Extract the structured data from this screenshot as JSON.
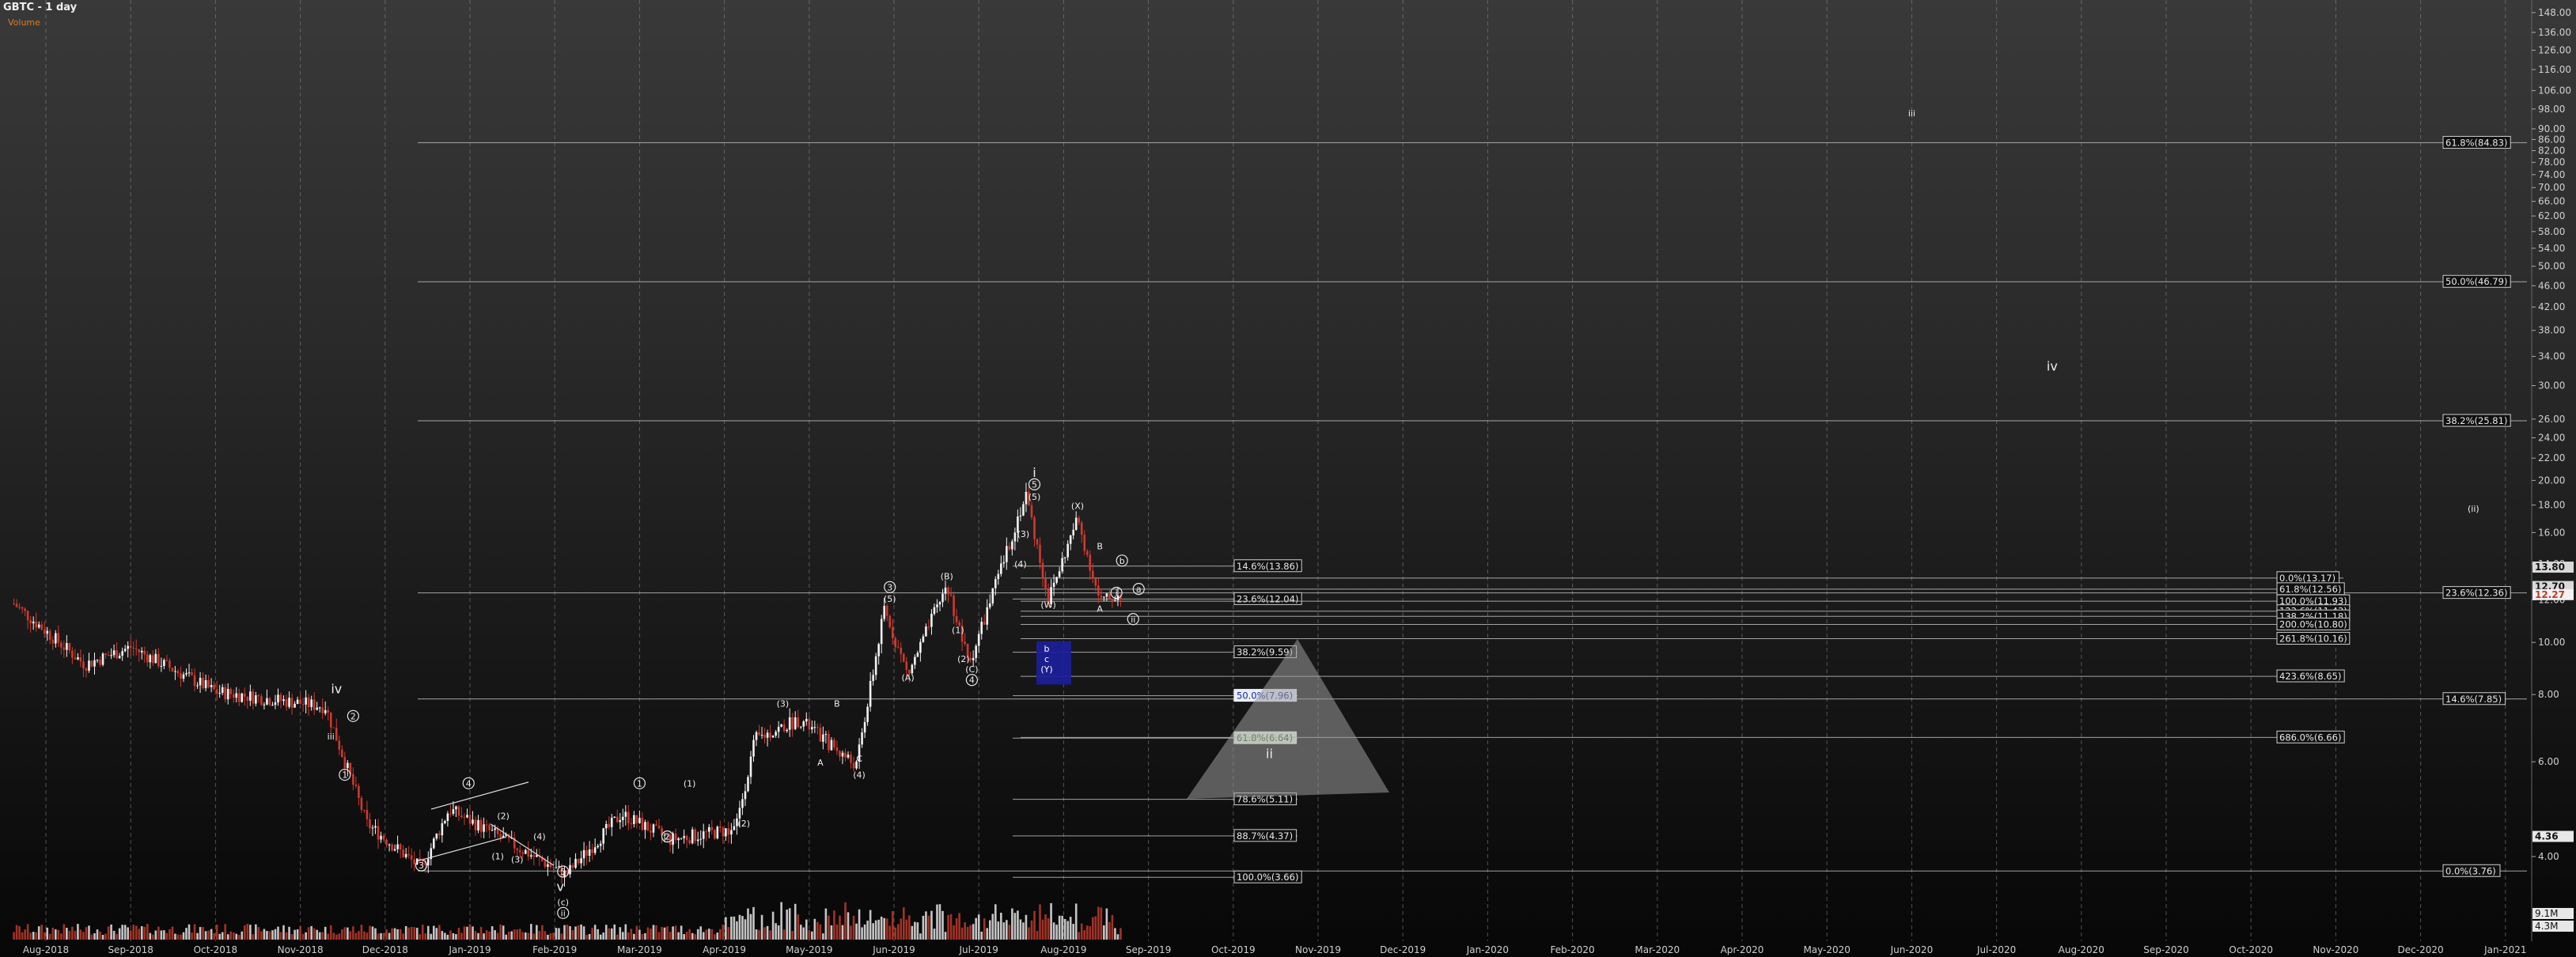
{
  "chart_data": {
    "type": "candlestick",
    "title": "GBTC - 1 day",
    "subtitle": "Volume",
    "x_ticks": [
      "Aug-2018",
      "Sep-2018",
      "Oct-2018",
      "Nov-2018",
      "Dec-2018",
      "Jan-2019",
      "Feb-2019",
      "Mar-2019",
      "Apr-2019",
      "May-2019",
      "Jun-2019",
      "Jul-2019",
      "Aug-2019",
      "Sep-2019",
      "Oct-2019",
      "Nov-2019",
      "Dec-2019",
      "Jan-2020",
      "Feb-2020",
      "Mar-2020",
      "Apr-2020",
      "May-2020",
      "Jun-2020",
      "Jul-2020",
      "Aug-2020",
      "Sep-2020",
      "Oct-2020",
      "Nov-2020",
      "Dec-2020",
      "Jan-2021"
    ],
    "y_scale": "log",
    "ylim": [
      3.0,
      150
    ],
    "y_ticks": [
      4.0,
      6.0,
      8.0,
      10.0,
      12.0,
      14.0,
      16.0,
      18.0,
      20.0,
      22.0,
      24.0,
      26.0,
      30.0,
      34.0,
      38.0,
      42.0,
      46.0,
      50.0,
      54.0,
      58.0,
      62.0,
      66.0,
      70.0,
      74.0,
      78.0,
      82.0,
      86.0,
      90.0,
      98.0,
      106.0,
      116.0,
      126.0,
      136.0,
      148.0
    ],
    "price_labels": [
      {
        "value": 13.8,
        "text": "13.80",
        "color": "#d9d9d9",
        "text_color": "#111111"
      },
      {
        "value": 12.7,
        "text": "12.70",
        "color": "#d9d9d9",
        "text_color": "#111111"
      },
      {
        "value": 12.27,
        "text": "12.27",
        "color": "#f2f2f2",
        "text_color": "#c0392b"
      },
      {
        "value": 4.36,
        "text": "4.36",
        "color": "#e8e8e8",
        "text_color": "#111111"
      }
    ],
    "volume_labels": [
      "9.1M",
      "4.3M"
    ],
    "right_fibs": [
      {
        "value": 84.83,
        "label": "61.8%(84.83)"
      },
      {
        "value": 46.79,
        "label": "50.0%(46.79)"
      },
      {
        "value": 25.81,
        "label": "38.2%(25.81)"
      },
      {
        "value": 12.36,
        "label": "23.6%(12.36)"
      },
      {
        "value": 7.85,
        "label": "14.6%(7.85)"
      },
      {
        "value": 3.76,
        "label": "0.0%(3.76)"
      }
    ],
    "mid_fibs": [
      {
        "value": 13.86,
        "label": "14.6%(13.86)"
      },
      {
        "value": 12.04,
        "label": "23.6%(12.04)"
      },
      {
        "value": 9.59,
        "label": "38.2%(9.59)"
      },
      {
        "value": 7.96,
        "label": "50.0%(7.96)",
        "style": "blue"
      },
      {
        "value": 6.64,
        "label": "61.8%(6.64)",
        "style": "green"
      },
      {
        "value": 5.11,
        "label": "78.6%(5.11)"
      },
      {
        "value": 4.37,
        "label": "88.7%(4.37)"
      },
      {
        "value": 3.66,
        "label": "100.0%(3.66)"
      }
    ],
    "ext_fibs": [
      {
        "value": 13.17,
        "label": "0.0%(13.17)"
      },
      {
        "value": 12.56,
        "label": "61.8%(12.56)"
      },
      {
        "value": 11.93,
        "label": "100.0%(11.93)"
      },
      {
        "value": 11.43,
        "label": "123.6%(11.43)"
      },
      {
        "value": 11.18,
        "label": "138.2%(11.18)"
      },
      {
        "value": 10.8,
        "label": "200.0%(10.80)"
      },
      {
        "value": 10.16,
        "label": "261.8%(10.16)"
      },
      {
        "value": 8.65,
        "label": "423.6%(8.65)"
      },
      {
        "value": 6.66,
        "label": "686.0%(6.66)"
      }
    ],
    "wave_labels": [
      {
        "text": "iv",
        "date": "2018-11-14",
        "price": 8.05
      },
      {
        "text": "iii",
        "date": "2018-11-12",
        "price": 6.6
      },
      {
        "text": "2",
        "date": "2018-11-20",
        "price": 7.2,
        "circled": true
      },
      {
        "text": "1",
        "date": "2018-11-17",
        "price": 5.6,
        "circled": true
      },
      {
        "text": "3",
        "date": "2018-12-14",
        "price": 3.8,
        "circled": true
      },
      {
        "text": "4",
        "date": "2018-12-31",
        "price": 5.4,
        "circled": true
      },
      {
        "text": "(2)",
        "date": "2019-01-13",
        "price": 4.7
      },
      {
        "text": "(1)",
        "date": "2019-01-11",
        "price": 3.95
      },
      {
        "text": "(3)",
        "date": "2019-01-18",
        "price": 3.9
      },
      {
        "text": "(4)",
        "date": "2019-01-26",
        "price": 4.3
      },
      {
        "text": "5",
        "date": "2019-02-04",
        "price": 3.7,
        "circled": true
      },
      {
        "text": "v",
        "date": "2019-02-03",
        "price": 3.45
      },
      {
        "text": "(c)",
        "date": "2019-02-04",
        "price": 3.25
      },
      {
        "text": "ii",
        "date": "2019-02-04",
        "price": 3.1,
        "circled": true
      },
      {
        "text": "1",
        "date": "2019-03-01",
        "price": 5.4,
        "circled": true
      },
      {
        "text": "2",
        "date": "2019-03-11",
        "price": 4.3,
        "circled": true
      },
      {
        "text": "(1)",
        "date": "2019-03-19",
        "price": 5.4
      },
      {
        "text": "(2)",
        "date": "2019-04-08",
        "price": 4.55
      },
      {
        "text": "(3)",
        "date": "2019-04-22",
        "price": 7.6
      },
      {
        "text": "A",
        "date": "2019-05-05",
        "price": 5.9
      },
      {
        "text": "B",
        "date": "2019-05-11",
        "price": 7.6
      },
      {
        "text": "C",
        "date": "2019-05-19",
        "price": 6.0
      },
      {
        "text": "(4)",
        "date": "2019-05-19",
        "price": 5.6
      },
      {
        "text": "3",
        "date": "2019-05-30",
        "price": 12.5,
        "circled": true
      },
      {
        "text": "(5)",
        "date": "2019-05-30",
        "price": 11.9
      },
      {
        "text": "(A)",
        "date": "2019-06-06",
        "price": 8.5
      },
      {
        "text": "(B)",
        "date": "2019-06-20",
        "price": 13.1
      },
      {
        "text": "(1)",
        "date": "2019-06-24",
        "price": 10.4
      },
      {
        "text": "(2)",
        "date": "2019-06-26",
        "price": 9.2
      },
      {
        "text": "(C)",
        "date": "2019-06-29",
        "price": 8.8
      },
      {
        "text": "4",
        "date": "2019-06-29",
        "price": 8.4,
        "circled": true
      },
      {
        "text": "i",
        "date": "2019-07-21",
        "price": 20.3
      },
      {
        "text": "5",
        "date": "2019-07-21",
        "price": 19.4,
        "circled": true
      },
      {
        "text": "(5)",
        "date": "2019-07-21",
        "price": 18.4
      },
      {
        "text": "(3)",
        "date": "2019-07-17",
        "price": 15.7
      },
      {
        "text": "(4)",
        "date": "2019-07-16",
        "price": 13.8
      },
      {
        "text": "(W)",
        "date": "2019-07-26",
        "price": 11.6
      },
      {
        "text": "(X)",
        "date": "2019-08-06",
        "price": 17.7
      },
      {
        "text": "B",
        "date": "2019-08-14",
        "price": 14.9
      },
      {
        "text": "A",
        "date": "2019-08-14",
        "price": 11.4
      },
      {
        "text": "b",
        "date": "2019-08-22",
        "price": 14.0,
        "circled": true
      },
      {
        "text": "a",
        "date": "2019-08-28",
        "price": 12.4,
        "circled": true
      },
      {
        "text": "i",
        "date": "2019-08-20",
        "price": 12.2,
        "circled": true
      },
      {
        "text": "ii",
        "date": "2019-08-26",
        "price": 10.9,
        "circled": true
      },
      {
        "text": "iii",
        "date": "2020-06-01",
        "price": 95.0
      },
      {
        "text": "iv",
        "date": "2020-07-21",
        "price": 32.0
      },
      {
        "text": "(ii)",
        "date": "2020-12-20",
        "price": 17.5
      },
      {
        "text": "ii",
        "date": "2019-10-14",
        "price": 6.1
      }
    ],
    "target_box": {
      "labels": [
        "b",
        "c",
        "(Y)"
      ]
    },
    "triangle": true
  }
}
